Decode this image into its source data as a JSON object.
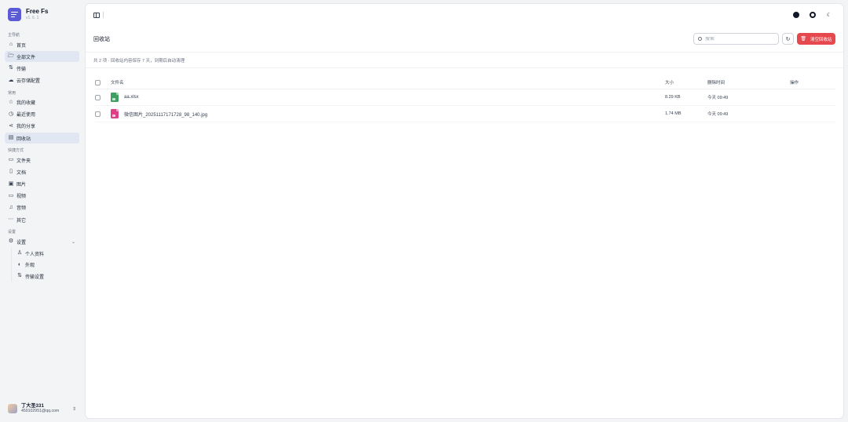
{
  "app": {
    "name": "Free Fs",
    "version": "v1. 6. 1"
  },
  "sidebar": {
    "groups": [
      {
        "label": "主导航",
        "items": [
          {
            "label": "首页",
            "icon": "home-icon"
          },
          {
            "label": "全部文件",
            "icon": "folder-open-icon",
            "active": true
          },
          {
            "label": "传输",
            "icon": "transfer-icon"
          },
          {
            "label": "云存储配置",
            "icon": "cloud-icon"
          }
        ]
      },
      {
        "label": "常用",
        "items": [
          {
            "label": "我的收藏",
            "icon": "star-icon"
          },
          {
            "label": "最近使用",
            "icon": "clock-icon"
          },
          {
            "label": "我的分享",
            "icon": "share-icon"
          },
          {
            "label": "回收站",
            "icon": "trash-icon",
            "active": true
          }
        ]
      },
      {
        "label": "快捷方式",
        "items": [
          {
            "label": "文件夹",
            "icon": "folder-icon"
          },
          {
            "label": "文档",
            "icon": "document-icon"
          },
          {
            "label": "图片",
            "icon": "image-icon"
          },
          {
            "label": "视频",
            "icon": "video-icon"
          },
          {
            "label": "音频",
            "icon": "music-icon"
          },
          {
            "label": "其它",
            "icon": "more-icon"
          }
        ]
      },
      {
        "label": "设置",
        "items": [
          {
            "label": "设置",
            "icon": "settings-icon"
          }
        ]
      }
    ],
    "settings_sub": [
      {
        "label": "个人资料",
        "icon": "user-icon"
      },
      {
        "label": "外观",
        "icon": "palette-icon"
      },
      {
        "label": "传输设置",
        "icon": "transfer-icon"
      }
    ]
  },
  "user": {
    "name": "丁大圣331",
    "email": "459102951@qq.com"
  },
  "page": {
    "title": "回收站",
    "search_placeholder": "搜索",
    "clear_button": "清空回收站",
    "info": "共 2 项 · 回收站内容保存 7 天，到期后自动清理"
  },
  "table": {
    "headers": {
      "name": "文件名",
      "size": "大小",
      "deleted": "删除时间",
      "ops": "操作"
    },
    "rows": [
      {
        "name": "aa.xlsx",
        "size": "8.29 KB",
        "deleted": "今天 09:49",
        "type": "xls"
      },
      {
        "name": "微信图片_20251117171728_98_140.jpg",
        "size": "1.74 MB",
        "deleted": "今天 09:49",
        "type": "img"
      }
    ]
  },
  "colors": {
    "accent": "#5b5bd6",
    "danger": "#e5484d",
    "active_bg": "#e0e7f3"
  }
}
